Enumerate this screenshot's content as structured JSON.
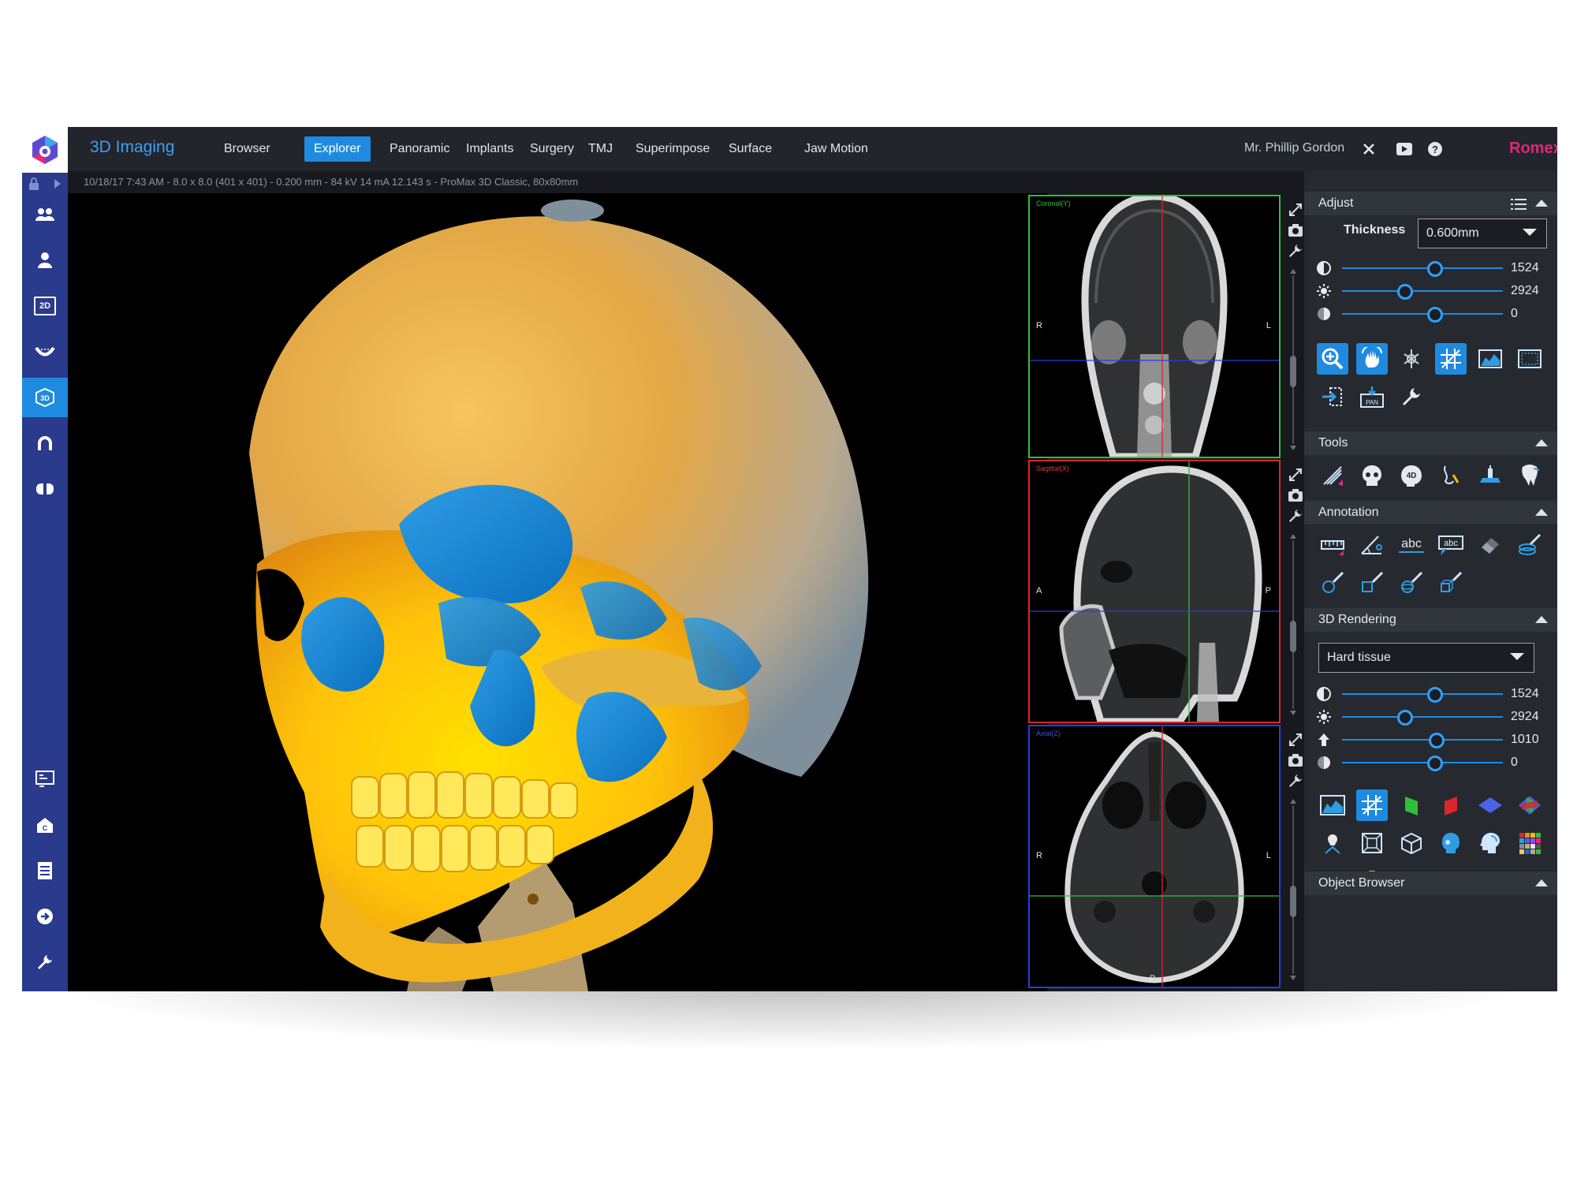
{
  "app": {
    "title": "3D Imaging",
    "brand": "Romexis",
    "user": "Mr. Phillip Gordon",
    "info": "10/18/17 7:43 AM - 8.0 x 8.0 (401 x 401) - 0.200 mm - 84 kV 14 mA 12.143 s - ProMax 3D Classic, 80x80mm"
  },
  "tabs": [
    {
      "label": "Browser",
      "active": false
    },
    {
      "label": "Explorer",
      "active": true
    },
    {
      "label": "Panoramic",
      "active": false
    },
    {
      "label": "Implants",
      "active": false
    },
    {
      "label": "Surgery",
      "active": false
    },
    {
      "label": "TMJ",
      "active": false
    },
    {
      "label": "Superimpose",
      "active": false
    },
    {
      "label": "Surface",
      "active": false
    },
    {
      "label": "Jaw Motion",
      "active": false
    }
  ],
  "rail": {
    "top_items": [
      "patients-icon",
      "patient-icon",
      "2d-icon",
      "dental-arch-icon",
      "3d-icon",
      "arch-icon",
      "cbct-icon"
    ],
    "active_item": "3d-icon",
    "bottom_items": [
      "queue-icon",
      "home-icon",
      "report-icon",
      "export-icon",
      "settings-icon"
    ],
    "label_2d": "2D",
    "label_3d": "3D"
  },
  "slices": {
    "coronal": {
      "label": "Coronal(Y)",
      "left": "R",
      "right": "L",
      "color": "#2fbf3a"
    },
    "sagittal": {
      "label": "Sagittal(X)",
      "left": "A",
      "right": "P",
      "color": "#d9262a"
    },
    "axial": {
      "label": "Axial(Z)",
      "top": "A",
      "left": "R",
      "right": "L",
      "bottom": "P",
      "color": "#2740d9"
    }
  },
  "adjust": {
    "title": "Adjust",
    "thickness_label": "Thickness",
    "thickness_value": "0.600mm",
    "sliders": [
      {
        "icon": "contrast-icon",
        "value": "1524",
        "level": 0.58
      },
      {
        "icon": "brightness-icon",
        "value": "2924",
        "level": 0.39
      },
      {
        "icon": "sharpness-icon",
        "value": "0",
        "level": 0.58
      }
    ],
    "pan_label": "PAN"
  },
  "tools": {
    "title": "Tools"
  },
  "annotation": {
    "title": "Annotation",
    "abc1": "abc",
    "abc2": "abc"
  },
  "rendering": {
    "title": "3D Rendering",
    "preset": "Hard tissue",
    "sliders": [
      {
        "icon": "contrast-icon",
        "value": "1524",
        "level": 0.58
      },
      {
        "icon": "brightness-icon",
        "value": "2924",
        "level": 0.39
      },
      {
        "icon": "threshold-icon",
        "value": "1010",
        "level": 0.59
      },
      {
        "icon": "opacity-icon",
        "value": "0",
        "level": 0.58
      }
    ]
  },
  "object_browser": {
    "title": "Object Browser"
  },
  "colors": {
    "accent": "#1f8be0",
    "rail": "#2a3a8c",
    "brand": "#e0287a",
    "panel": "#26292f",
    "topbar": "#22252c"
  }
}
